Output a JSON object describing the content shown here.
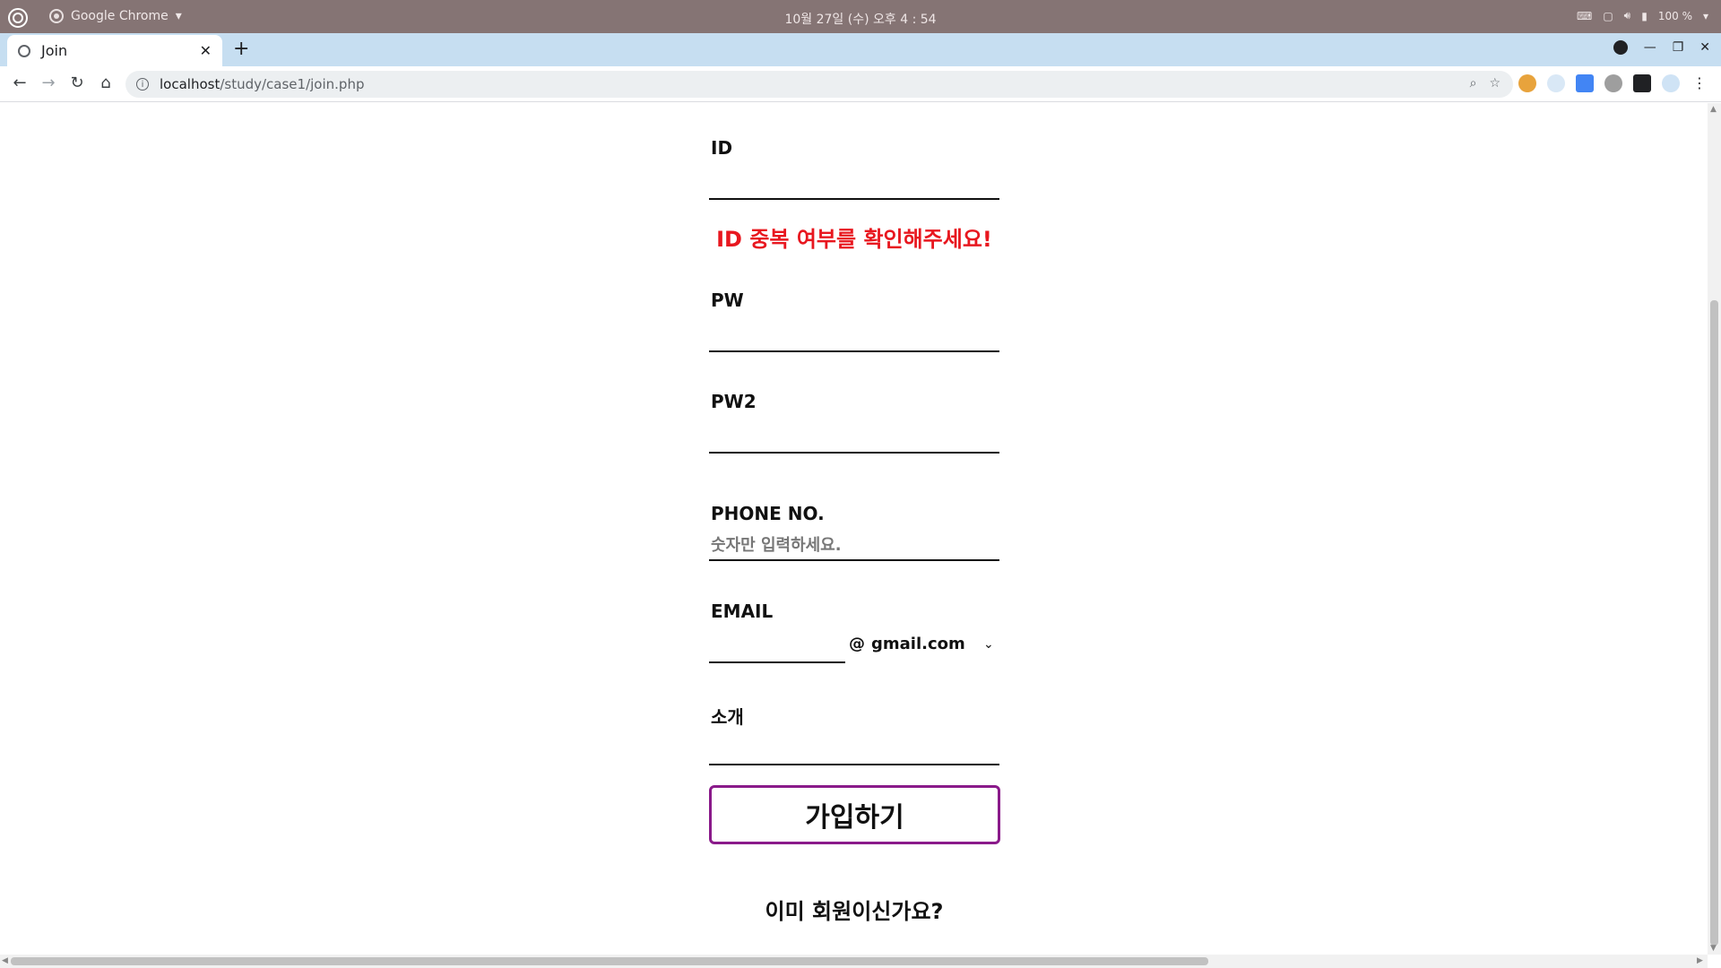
{
  "os": {
    "app_name": "Google Chrome",
    "clock": "10월 27일 (수) 오후 4 : 54",
    "battery": "100 %"
  },
  "browser": {
    "tab_title": "Join",
    "url_host": "localhost",
    "url_path": "/study/case1/join.php"
  },
  "form": {
    "id_label": "ID",
    "id_error": "ID 중복 여부를 확인해주세요!",
    "pw_label": "PW",
    "pw2_label": "PW2",
    "phone_label": "PHONE NO.",
    "phone_placeholder": "숫자만 입력하세요.",
    "email_label": "EMAIL",
    "email_at": "@",
    "email_domain": "gmail.com",
    "intro_label": "소개",
    "submit_label": "가입하기",
    "already_member": "이미 회원이신가요?"
  }
}
